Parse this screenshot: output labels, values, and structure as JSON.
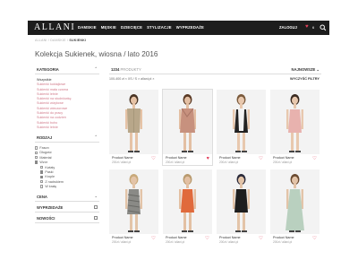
{
  "brand": "ALLANI",
  "nav": [
    "DAMSKIE",
    "MĘSKIE",
    "DZIECIĘCE",
    "STYLIZACJE",
    "WYPRZEDAŻE"
  ],
  "login": "ZALOGUJ",
  "favorites_count": "6",
  "breadcrumb": [
    "ALLANI",
    "DAMSKIE",
    "SUKIENKI"
  ],
  "title": "Kolekcja Sukienek, wiosna / lato 2016",
  "sidebar": {
    "category_title": "KATEGORIA",
    "categories": [
      "Wszystkie",
      "Sukienki koktajlowe",
      "Sukienki mała czarna",
      "Sukienki letnie",
      "Sukienki na studniówkę",
      "Sukienki wizytowe",
      "Sukienki wieczorowe",
      "Sukienki do pracy",
      "Sukienki na codzień",
      "Sukienki boho",
      "Sukienki letnie"
    ],
    "type_title": "RODZAJ",
    "types": [
      {
        "label": "Fason",
        "checked": false
      },
      {
        "label": "Długość",
        "checked": false
      },
      {
        "label": "Materiał",
        "checked": false
      },
      {
        "label": "Wzór",
        "checked": true
      }
    ],
    "patterns": [
      {
        "label": "Kwiaty",
        "checked": false
      },
      {
        "label": "Paski",
        "checked": true
      },
      {
        "label": "Krople",
        "checked": true
      },
      {
        "label": "Z nadrukiem",
        "checked": false
      },
      {
        "label": "W kratę",
        "checked": false
      }
    ],
    "price_title": "CENA",
    "sale_title": "WYPRZEDAŻE",
    "new_title": "NOWOŚCI"
  },
  "results": {
    "count": "1234",
    "count_label": "PRODUKTY"
  },
  "sort_label": "NAJNOWSZE",
  "filter_summary": "100-400 zł ×   XS / S ×   allani.pl ×",
  "clear_filters": "WYCZYŚĆ FILTRY",
  "products": [
    {
      "name": "Product Name",
      "price": "200zł / allani.pl",
      "dress": "#b8a78a",
      "skin": "#e6c3a6",
      "hair": "#4a3525",
      "favorite": false,
      "style": "shirt"
    },
    {
      "name": "Product Name",
      "price": "200zł / allani.pl",
      "dress": "#c7917e",
      "skin": "#e3bfa3",
      "hair": "#5a3a25",
      "favorite": true,
      "style": "drape"
    },
    {
      "name": "Product Name",
      "price": "200zł / allani.pl",
      "dress": "#222222",
      "skin": "#e8c8ae",
      "hair": "#7a5a3c",
      "favorite": false,
      "style": "mono"
    },
    {
      "name": "Product Name",
      "price": "200zł / allani.pl",
      "dress": "#e8b2ae",
      "skin": "#e8c8ae",
      "hair": "#3a2a20",
      "favorite": false,
      "style": "plain"
    },
    {
      "name": "Product Name",
      "price": "200zł / allani.pl",
      "dress": "#8a8a86",
      "skin": "#e3c4a8",
      "hair": "#c8a97a",
      "favorite": false,
      "style": "print"
    },
    {
      "name": "Product Name",
      "price": "200zł / allani.pl",
      "dress": "#e06a3c",
      "skin": "#e3c0a3",
      "hair": "#b89a6e",
      "favorite": false,
      "style": "plain"
    },
    {
      "name": "Product Name",
      "price": "200zł / allani.pl",
      "dress": "#1e1e1e",
      "skin": "#e3c4a8",
      "hair": "#2a2a3a",
      "favorite": false,
      "style": "plain"
    },
    {
      "name": "Product Name",
      "price": "200zł / allani.pl",
      "dress": "#b9d0bf",
      "skin": "#e3c4a8",
      "hair": "#6a4a30",
      "favorite": false,
      "style": "maxi"
    }
  ]
}
